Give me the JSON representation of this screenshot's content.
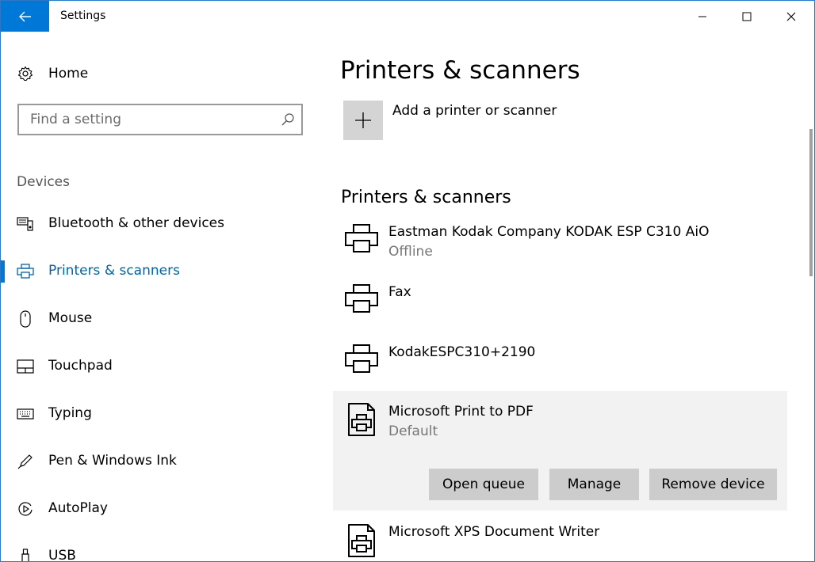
{
  "window": {
    "title": "Settings"
  },
  "sidebar": {
    "home_label": "Home",
    "search_placeholder": "Find a setting",
    "section_heading": "Devices",
    "items": [
      {
        "label": "Bluetooth & other devices",
        "icon": "bluetooth-devices-icon"
      },
      {
        "label": "Printers & scanners",
        "icon": "printer-icon",
        "active": true
      },
      {
        "label": "Mouse",
        "icon": "mouse-icon"
      },
      {
        "label": "Touchpad",
        "icon": "touchpad-icon"
      },
      {
        "label": "Typing",
        "icon": "keyboard-icon"
      },
      {
        "label": "Pen & Windows Ink",
        "icon": "pen-icon"
      },
      {
        "label": "AutoPlay",
        "icon": "autoplay-icon"
      },
      {
        "label": "USB",
        "icon": "usb-icon"
      }
    ]
  },
  "main": {
    "title": "Printers & scanners",
    "add_label": "Add a printer or scanner",
    "list_heading": "Printers & scanners",
    "devices": [
      {
        "name": "Eastman Kodak Company KODAK ESP C310 AiO",
        "status": "Offline"
      },
      {
        "name": "Fax",
        "status": ""
      },
      {
        "name": "KodakESPC310+2190",
        "status": ""
      },
      {
        "name": "Microsoft Print to PDF",
        "status": "Default"
      },
      {
        "name": "Microsoft XPS Document Writer",
        "status": ""
      }
    ],
    "actions": {
      "open_queue": "Open queue",
      "manage": "Manage",
      "remove_device": "Remove device"
    }
  },
  "colors": {
    "accent": "#0078d7",
    "accent_text": "#0063b1",
    "selected_row": "#f2f2f2",
    "button_bg": "#cccccc"
  }
}
